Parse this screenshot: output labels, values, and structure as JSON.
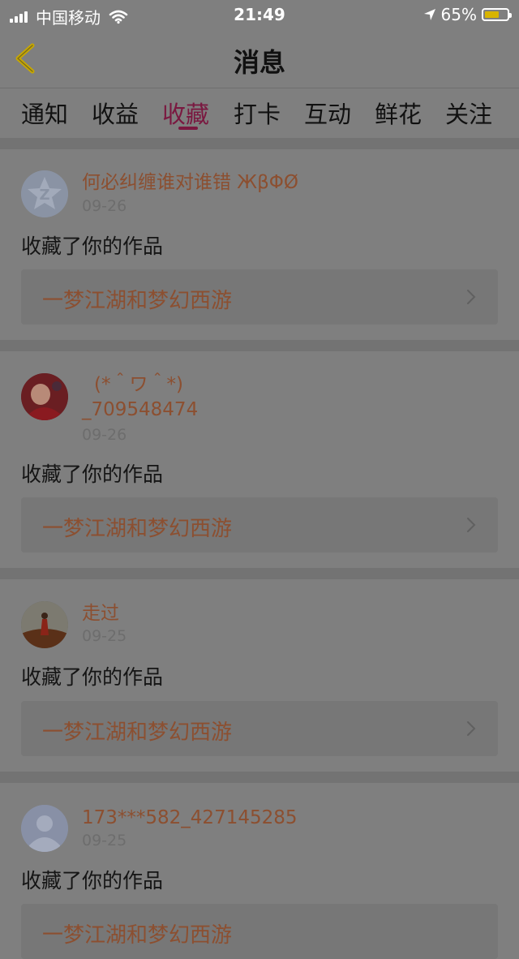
{
  "status_bar": {
    "carrier": "中国移动",
    "time": "21:49",
    "battery": "65%",
    "battery_level": 0.65,
    "battery_color": "#d8b400"
  },
  "nav": {
    "title": "消息",
    "back_icon": "chevron-left-icon"
  },
  "tabs": [
    {
      "label": "通知"
    },
    {
      "label": "收益"
    },
    {
      "label": "收藏",
      "active": true
    },
    {
      "label": "打卡"
    },
    {
      "label": "互动"
    },
    {
      "label": "鲜花"
    },
    {
      "label": "关注"
    }
  ],
  "items": [
    {
      "username": "何必纠缠谁对谁错 ЖβΦØ",
      "date": "09-26",
      "action": "收藏了你的作品",
      "work_title": "一梦江湖和梦幻西游"
    },
    {
      "username_line1": "(*＾ワ＾*)",
      "username_line2": "_709548474",
      "date": "09-26",
      "action": "收藏了你的作品",
      "work_title": "一梦江湖和梦幻西游"
    },
    {
      "username": "走过",
      "date": "09-25",
      "action": "收藏了你的作品",
      "work_title": "一梦江湖和梦幻西游"
    },
    {
      "username": "173***582_427145285",
      "date": "09-25",
      "action": "收藏了你的作品",
      "work_title": "一梦江湖和梦幻西游"
    }
  ]
}
